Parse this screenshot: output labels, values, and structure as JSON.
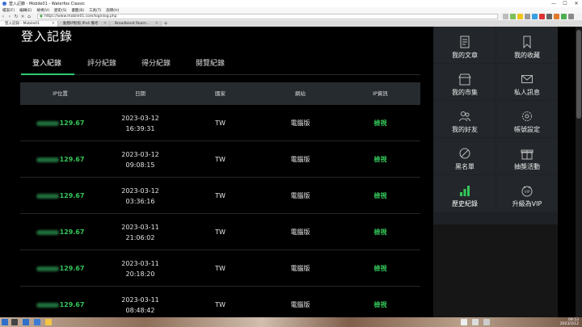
{
  "window": {
    "title": "登入記錄 - Mobile01 - Waterfox Classic",
    "controls": [
      "—",
      "☐",
      "✕"
    ]
  },
  "menu": [
    "檔案(F)",
    "編輯(E)",
    "檢視(V)",
    "歷史(S)",
    "書籤(B)",
    "工具(T)",
    "說明(H)"
  ],
  "nav": {
    "url": "https://www.mobile01.com/loginlog.php"
  },
  "browser_tabs": [
    {
      "label": "登入記錄 - Mobile01",
      "active": true
    },
    {
      "label": "動態IP對照 IPv4 備考",
      "active": false
    },
    {
      "label": "Broadband Roam...",
      "active": false
    }
  ],
  "page": {
    "title": "登入記錄",
    "tabs": [
      "登入紀錄",
      "評分紀錄",
      "得分紀錄",
      "閱覽紀錄"
    ],
    "active_tab_index": 0,
    "table": {
      "headers": [
        "IP位置",
        "日期",
        "國家",
        "網站",
        "IP資訊"
      ],
      "rows": [
        {
          "ip_suffix": "129.67",
          "date": "2023-03-12",
          "time": "16:39:31",
          "country": "TW",
          "site": "電腦版",
          "action": "檢視"
        },
        {
          "ip_suffix": "129.67",
          "date": "2023-03-12",
          "time": "09:08:15",
          "country": "TW",
          "site": "電腦版",
          "action": "檢視"
        },
        {
          "ip_suffix": "129.67",
          "date": "2023-03-12",
          "time": "03:36:16",
          "country": "TW",
          "site": "電腦版",
          "action": "檢視"
        },
        {
          "ip_suffix": "129.67",
          "date": "2023-03-11",
          "time": "21:06:02",
          "country": "TW",
          "site": "電腦版",
          "action": "檢視"
        },
        {
          "ip_suffix": "129.67",
          "date": "2023-03-11",
          "time": "20:18:20",
          "country": "TW",
          "site": "電腦版",
          "action": "檢視"
        },
        {
          "ip_suffix": "129.67",
          "date": "2023-03-11",
          "time": "08:48:42",
          "country": "TW",
          "site": "電腦版",
          "action": "檢視"
        }
      ]
    }
  },
  "sidebar": {
    "items": [
      {
        "label": "我的文章",
        "icon": "article-icon"
      },
      {
        "label": "我的收藏",
        "icon": "bookmark-icon"
      },
      {
        "label": "我的市集",
        "icon": "store-icon"
      },
      {
        "label": "私人訊息",
        "icon": "mail-icon"
      },
      {
        "label": "我的好友",
        "icon": "friends-icon"
      },
      {
        "label": "帳號設定",
        "icon": "gear-icon"
      },
      {
        "label": "黑名單",
        "icon": "block-icon"
      },
      {
        "label": "抽獎活動",
        "icon": "gift-icon"
      },
      {
        "label": "歷史紀錄",
        "icon": "history-chart-icon"
      },
      {
        "label": "升級為VIP",
        "icon": "vip-icon"
      }
    ],
    "highlight_index": 8
  },
  "taskbar": {
    "clock": "09:53",
    "date": "2023/3/12"
  },
  "colors": {
    "accent": "#34c759",
    "page_bg": "#000000",
    "table_header_bg": "#262b30",
    "sidebar_bg": "#23272b"
  }
}
